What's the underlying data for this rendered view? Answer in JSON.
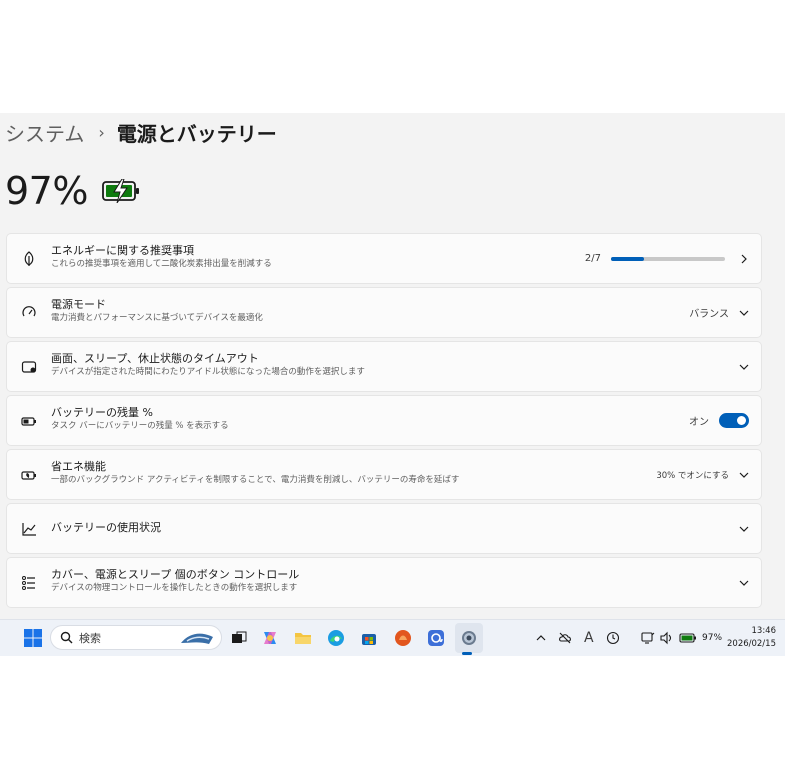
{
  "breadcrumb": {
    "parent": "システム",
    "separator": "›",
    "current": "電源とバッテリー"
  },
  "battery": {
    "percent_label": "97%",
    "level_percent": 97,
    "charging": true,
    "accent": "#0f7b0f"
  },
  "cards": [
    {
      "title": "エネルギーに関する推奨事項",
      "subtitle": "これらの推奨事項を適用して二酸化炭素排出量を削減する",
      "value": "2/7",
      "progress_fraction": 0.2857,
      "icon": "leaf-icon",
      "control": "chevron-right"
    },
    {
      "title": "電源モード",
      "subtitle": "電力消費とパフォーマンスに基づいてデバイスを最適化",
      "value": "バランス",
      "icon": "power-mode-icon",
      "control": "chevron-down"
    },
    {
      "title": "画面、スリープ、休止状態のタイムアウト",
      "subtitle": "デバイスが指定された時間にわたりアイドル状態になった場合の動作を選択します",
      "value": "",
      "icon": "screen-sleep-icon",
      "control": "chevron-down"
    },
    {
      "title": "バッテリーの残量 %",
      "subtitle": "タスク バーにバッテリーの残量 % を表示する",
      "value": "オン",
      "toggle_on": true,
      "icon": "battery-percent-icon",
      "control": "toggle"
    },
    {
      "title": "省エネ機能",
      "subtitle": "一部のバックグラウンド アクティビティを制限することで、電力消費を削減し、バッテリーの寿命を延ばす",
      "value": "30% でオンにする",
      "icon": "energy-saver-icon",
      "control": "chevron-down"
    },
    {
      "title": "バッテリーの使用状況",
      "subtitle": "",
      "value": "",
      "icon": "usage-chart-icon",
      "control": "chevron-down"
    },
    {
      "title": "カバー、電源とスリープ 個のボタン コントロール",
      "subtitle": "デバイスの物理コントロールを操作したときの動作を選択します",
      "value": "",
      "icon": "button-controls-icon",
      "control": "chevron-down"
    }
  ],
  "taskbar": {
    "search_placeholder": "検索",
    "apps": [
      "start-icon",
      "widgets-icon",
      "task-view-icon",
      "copilot-icon",
      "file-explorer-icon",
      "edge-icon",
      "store-icon",
      "app-orange-icon",
      "mail-icon",
      "settings-icon"
    ],
    "tray": {
      "battery_label": "97%"
    },
    "time": "13:46",
    "date": "2026/02/15"
  },
  "colors": {
    "accent": "#005fb8",
    "window_bg": "#f3f3f3",
    "card_bg": "#fbfbfb"
  }
}
